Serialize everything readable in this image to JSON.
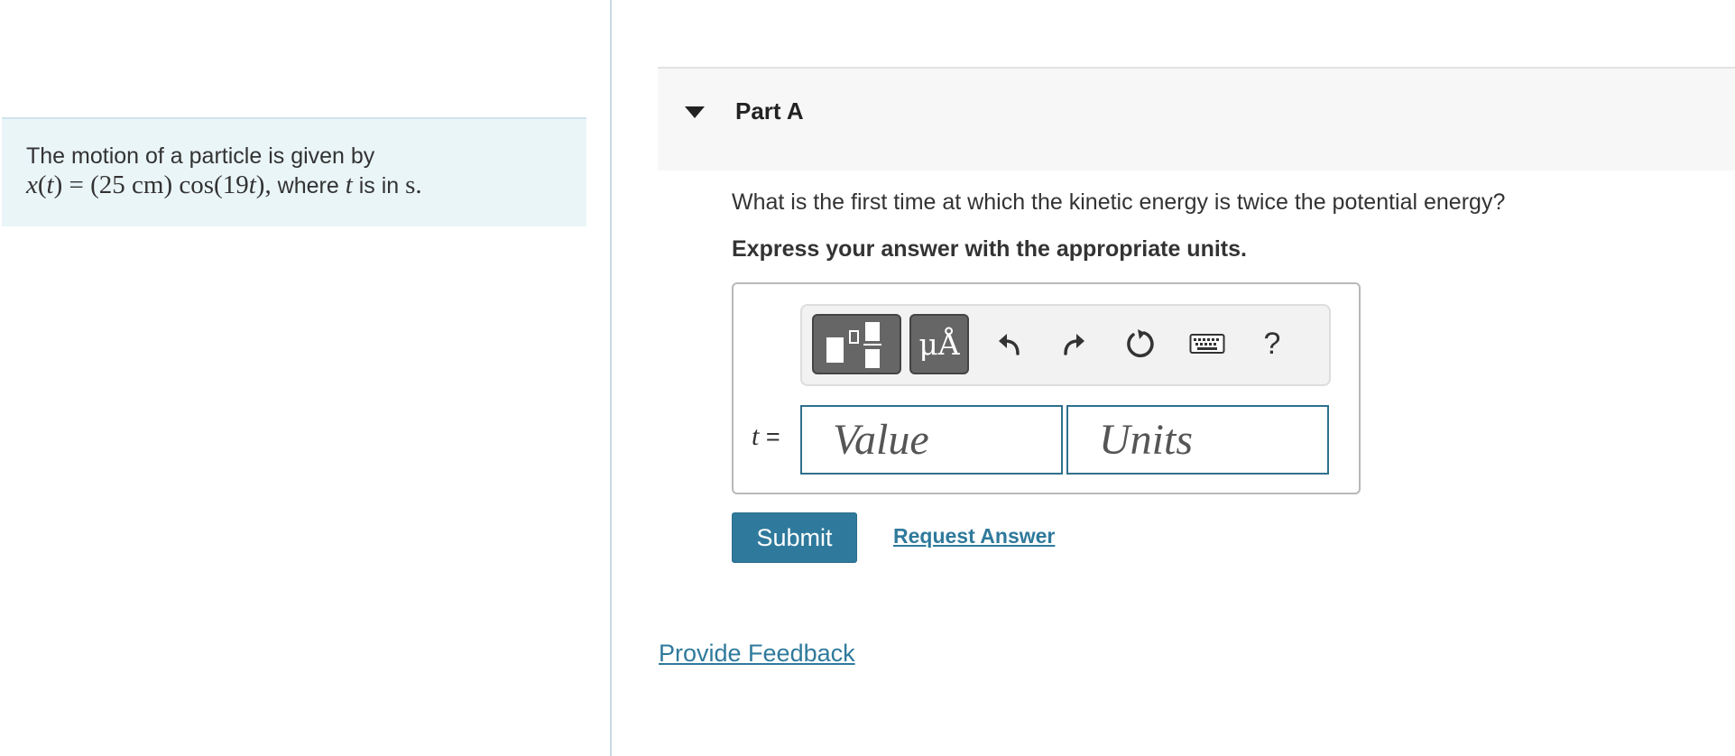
{
  "problem": {
    "line1": "The motion of a particle is given by",
    "eq_lhs": "x",
    "eq_arg": "t",
    "eq_amp": "= (25 cm)",
    "eq_cos": "cos(19",
    "eq_cos_var": "t",
    "eq_close": "),",
    "where_text": " where ",
    "where_var": "t",
    "where_suffix": " is in ",
    "unit": "s."
  },
  "part": {
    "title": "Part A",
    "question": "What is the first time at which the kinetic energy is twice the potential energy?",
    "instruction": "Express your answer with the appropriate units."
  },
  "toolbar": {
    "units_glyph": "μÅ",
    "help_label": "?",
    "icons": [
      "templates-icon",
      "units-icon",
      "undo-icon",
      "redo-icon",
      "reset-icon",
      "keyboard-icon",
      "help-icon"
    ]
  },
  "answer": {
    "variable": "t",
    "equals": " =",
    "value_placeholder": "Value",
    "units_placeholder": "Units",
    "value": "",
    "units": ""
  },
  "actions": {
    "submit_label": "Submit",
    "request_label": "Request Answer",
    "feedback_label": "Provide Feedback"
  },
  "colors": {
    "accent": "#2f7a9c",
    "problem_bg": "#eaf5f8",
    "header_bg": "#f7f7f7"
  }
}
